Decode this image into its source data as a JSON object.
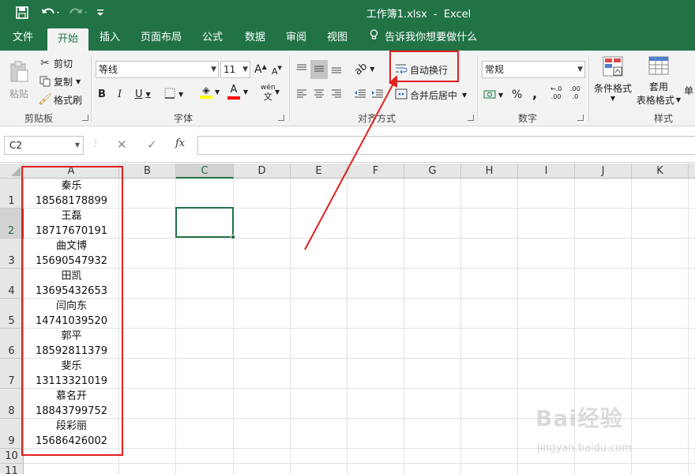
{
  "title_bar": {
    "doc_name": "工作簿1.xlsx",
    "separator": "-",
    "app_name": "Excel",
    "qa_icons": [
      "save-icon",
      "undo-icon",
      "redo-icon",
      "customize-icon"
    ]
  },
  "ribbon_tabs": [
    {
      "label": "文件"
    },
    {
      "label": "开始",
      "active": true
    },
    {
      "label": "插入"
    },
    {
      "label": "页面布局"
    },
    {
      "label": "公式"
    },
    {
      "label": "数据"
    },
    {
      "label": "审阅"
    },
    {
      "label": "视图"
    }
  ],
  "tell_me": "告诉我你想要做什么",
  "clipboard": {
    "paste": "粘贴",
    "cut": "剪切",
    "copy": "复制",
    "format_painter": "格式刷",
    "group_label": "剪贴板"
  },
  "font": {
    "name": "等线",
    "size": "11",
    "grow": "A",
    "shrink": "A",
    "bold": "B",
    "italic": "I",
    "underline": "U",
    "font_color_letter": "A",
    "wen": "wén",
    "wen2": "文",
    "group_label": "字体",
    "highlight_color": "#ffff00",
    "font_color": "#ff0000"
  },
  "alignment": {
    "wrap_text": "自动换行",
    "merge_center": "合并后居中",
    "group_label": "对齐方式"
  },
  "number": {
    "format": "常规",
    "currency": "¥",
    "percent": "%",
    "comma": ",",
    "inc_decimal": ".00",
    "dec_decimal": ".0",
    "group_label": "数字"
  },
  "styles": {
    "cond_format": "条件格式",
    "table_format_1": "套用",
    "table_format_2": "表格格式",
    "cell_styles_partial": "单",
    "group_label": "样式"
  },
  "formula_bar": {
    "name_box": "C2",
    "cancel": "✕",
    "enter": "✓",
    "fx": "fx",
    "value": ""
  },
  "columns": [
    "A",
    "B",
    "C",
    "D",
    "E",
    "F",
    "G",
    "H",
    "I",
    "J",
    "K"
  ],
  "selected_column": "C",
  "selected_row": "2",
  "rows": [
    "1",
    "2",
    "3",
    "4",
    "5",
    "6",
    "7",
    "8",
    "9",
    "10",
    "11"
  ],
  "cells_a": [
    {
      "name": "秦乐",
      "phone": "18568178899"
    },
    {
      "name": "王磊",
      "phone": "18717670191"
    },
    {
      "name": "曲文博",
      "phone": "15690547932"
    },
    {
      "name": "田凯",
      "phone": "13695432653"
    },
    {
      "name": "闫向东",
      "phone": "14741039520"
    },
    {
      "name": "郭平",
      "phone": "18592811379"
    },
    {
      "name": "斐乐",
      "phone": "13113321019"
    },
    {
      "name": "慕名开",
      "phone": "18843799752"
    },
    {
      "name": "段彩丽",
      "phone": "15686426002"
    }
  ],
  "watermark": {
    "brand": "Bai经验",
    "url": "jingyan.baidu.com"
  },
  "colors": {
    "excel_green": "#217346",
    "annotation_red": "#e02020"
  }
}
